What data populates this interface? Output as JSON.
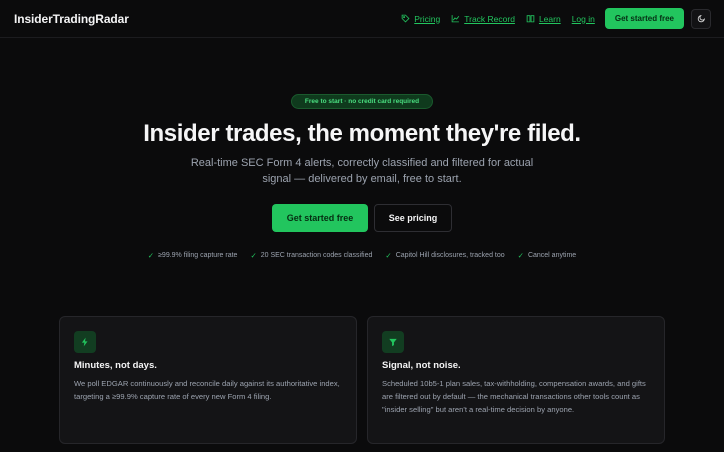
{
  "nav": {
    "brand": "InsiderTradingRadar",
    "links": [
      {
        "label": "Pricing",
        "icon": "tag-icon"
      },
      {
        "label": "Track Record",
        "icon": "chart-icon"
      },
      {
        "label": "Learn",
        "icon": "book-icon"
      },
      {
        "label": "Log in"
      }
    ],
    "cta": "Get started free",
    "theme_icon": "moon-icon"
  },
  "hero": {
    "badge": "Free to start · no credit card required",
    "title": "Insider trades, the moment they're filed.",
    "subtitle": "Real-time SEC Form 4 alerts, correctly classified and filtered for actual signal — delivered by email, free to start.",
    "primary_cta": "Get started free",
    "secondary_cta": "See pricing",
    "checks": [
      "≥99.9% filing capture rate",
      "20 SEC transaction codes classified",
      "Capitol Hill disclosures, tracked too",
      "Cancel anytime"
    ]
  },
  "features": [
    {
      "icon": "lightning-icon",
      "title": "Minutes, not days.",
      "body": "We poll EDGAR continuously and reconcile daily against its authoritative index, targeting a ≥99.9% capture rate of every new Form 4 filing."
    },
    {
      "icon": "filter-icon",
      "title": "Signal, not noise.",
      "body": "Scheduled 10b5-1 plan sales, tax-withholding, compensation awards, and gifts are filtered out by default — the mechanical transactions other tools count as \"insider selling\" but aren't a real-time decision by anyone."
    }
  ],
  "colors": {
    "accent": "#22c55e",
    "background": "#0b0b0c",
    "card": "#141416",
    "muted_text": "#9ca3af"
  }
}
